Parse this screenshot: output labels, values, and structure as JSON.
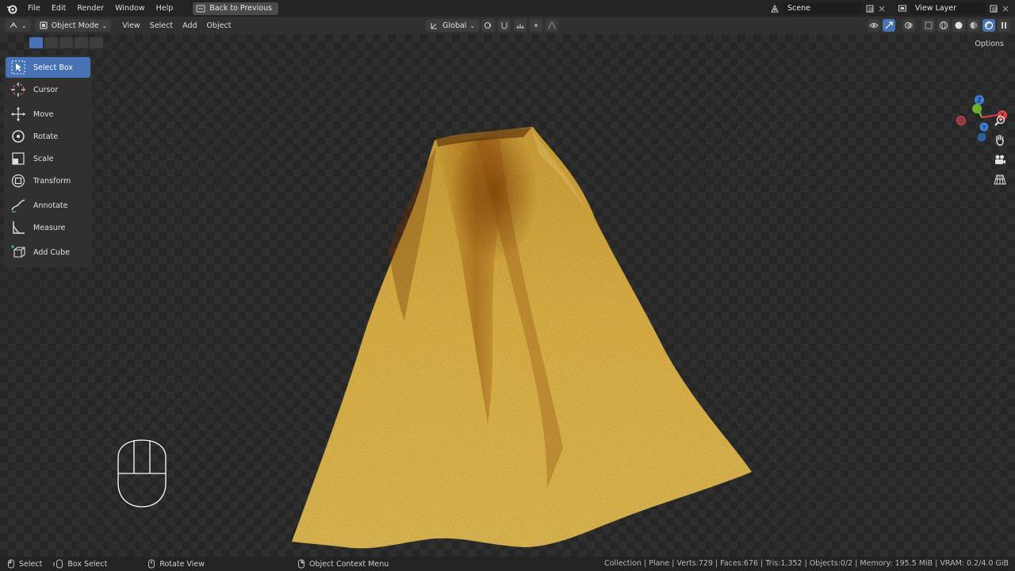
{
  "menu": {
    "items": [
      "File",
      "Edit",
      "Render",
      "Window",
      "Help"
    ],
    "back_button": "Back to Previous"
  },
  "top_right": {
    "scene": "Scene",
    "view_layer": "View Layer"
  },
  "header": {
    "mode": "Object Mode",
    "menus": [
      "View",
      "Select",
      "Add",
      "Object"
    ],
    "orientation": "Global"
  },
  "toolbar": {
    "tools": [
      {
        "label": "Select Box",
        "icon": "select-box-icon",
        "active": true
      },
      {
        "label": "Cursor",
        "icon": "cursor-icon"
      },
      {
        "label": "Move",
        "icon": "move-icon"
      },
      {
        "label": "Rotate",
        "icon": "rotate-icon"
      },
      {
        "label": "Scale",
        "icon": "scale-icon"
      },
      {
        "label": "Transform",
        "icon": "transform-icon"
      },
      {
        "label": "Annotate",
        "icon": "annotate-icon"
      },
      {
        "label": "Measure",
        "icon": "measure-icon"
      },
      {
        "label": "Add Cube",
        "icon": "add-cube-icon"
      }
    ]
  },
  "viewport": {
    "options_label": "Options",
    "gizmo": {
      "x": "X",
      "y": "Y",
      "z": "Z"
    }
  },
  "status": {
    "hints": [
      {
        "label": "Select",
        "icon": "mouse-left-icon"
      },
      {
        "label": "Box Select",
        "icon": "mouse-drag-icon"
      },
      {
        "label": "Rotate View",
        "icon": "mouse-middle-icon"
      },
      {
        "label": "Object Context Menu",
        "icon": "mouse-right-icon"
      }
    ],
    "stats": "Collection | Plane | Verts:729 | Faces:676 | Tris:1,352 | Objects:0/2 | Memory: 195.5 MiB | VRAM: 0.2/4.0 GiB"
  },
  "colors": {
    "accent": "#4772b3",
    "cloth": "#e3b84a",
    "axis_x": "#e0404a",
    "axis_y": "#6fae2c",
    "axis_z": "#3d7ed8"
  }
}
